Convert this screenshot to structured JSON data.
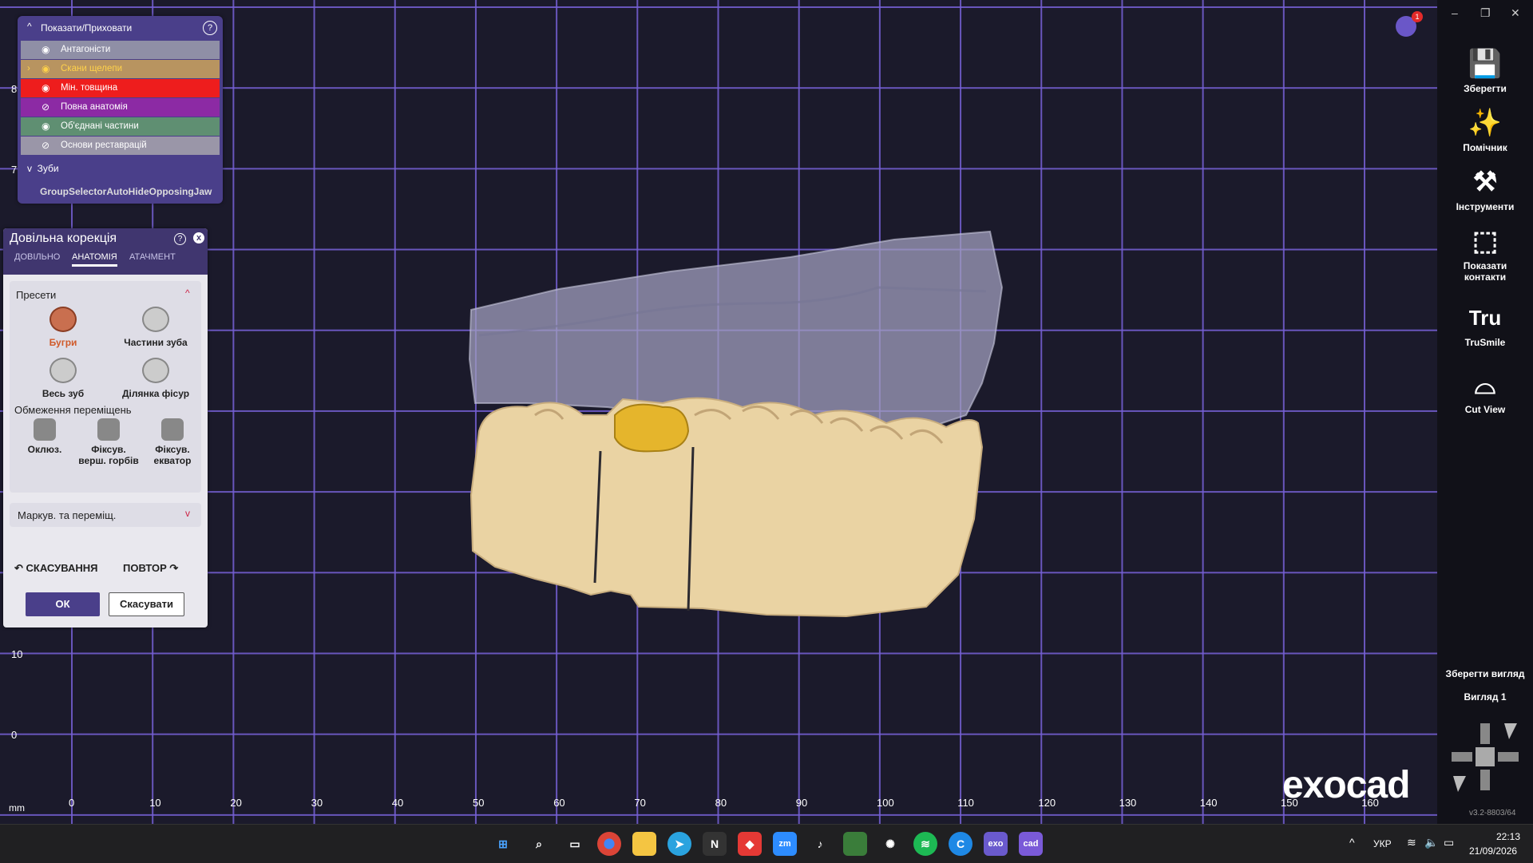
{
  "viewport": {
    "ruler_y": [
      "8",
      "7",
      "10",
      "0"
    ],
    "ruler_x": [
      "0",
      "10",
      "20",
      "30",
      "40",
      "50",
      "60",
      "70",
      "80",
      "90",
      "100",
      "110",
      "120",
      "130",
      "140",
      "150",
      "160"
    ],
    "unit_label": "mm",
    "logo": "exocad",
    "notification_count": "1"
  },
  "showhide": {
    "title": "Показати/Приховати",
    "rows": [
      {
        "label": "Антагоністи",
        "color": "#8f8fa6",
        "text_color": "#ffffff",
        "visible": true
      },
      {
        "label": "Скани щелепи",
        "color": "#b89460",
        "text_color": "#ffd24a",
        "visible": true,
        "expandable": true
      },
      {
        "label": "Мін. товщина",
        "color": "#ee1d1d",
        "text_color": "#ffffff",
        "visible": true
      },
      {
        "label": "Повна анатомія",
        "color": "#8c2aa4",
        "text_color": "#ffffff",
        "visible": false
      },
      {
        "label": "Об'єднані частини",
        "color": "#5f8f72",
        "text_color": "#ffffff",
        "visible": true
      },
      {
        "label": "Основи реставрацій",
        "color": "#9a96a8",
        "text_color": "#ffffff",
        "visible": false
      }
    ],
    "teeth_label": "Зуби",
    "selector_text": "GroupSelectorAutoHideOpposingJaw"
  },
  "correction": {
    "title": "Довільна корекція",
    "tabs": [
      "ДОВІЛЬНО",
      "АНАТОМІЯ",
      "АТАЧМЕНТ"
    ],
    "active_tab": "АНАТОМІЯ",
    "presets_title": "Пресети",
    "presets": [
      "Бугри",
      "Частини зуба",
      "Весь зуб",
      "Ділянка фісур"
    ],
    "limits_title": "Обмеження переміщень",
    "limits": [
      "Оклюз.",
      "Фіксув. верш. горбів",
      "Фіксув. екватор"
    ],
    "marking_label": "Маркув. та переміщ.",
    "undo_label": "СКАСУВАННЯ",
    "redo_label": "ПОВТОР",
    "ok_label": "ОК",
    "cancel_label": "Скасувати"
  },
  "sidebar": {
    "items": [
      {
        "label": "Зберегти",
        "icon": "save-icon"
      },
      {
        "label": "Помічник",
        "icon": "wand-icon"
      },
      {
        "label": "Інструменти",
        "icon": "tools-icon"
      },
      {
        "label": "Показати контакти",
        "icon": "contacts-icon"
      },
      {
        "label": "TruSmile",
        "icon": "trusmile-icon"
      },
      {
        "label": "Cut View",
        "icon": "cutview-icon"
      }
    ],
    "save_view_label": "Зберегти вигляд",
    "view_label": "Вигляд 1",
    "version": "v3.2-8803/64"
  },
  "taskbar": {
    "lang": "УКР",
    "time": "22:13",
    "date": "21/09/2026"
  }
}
